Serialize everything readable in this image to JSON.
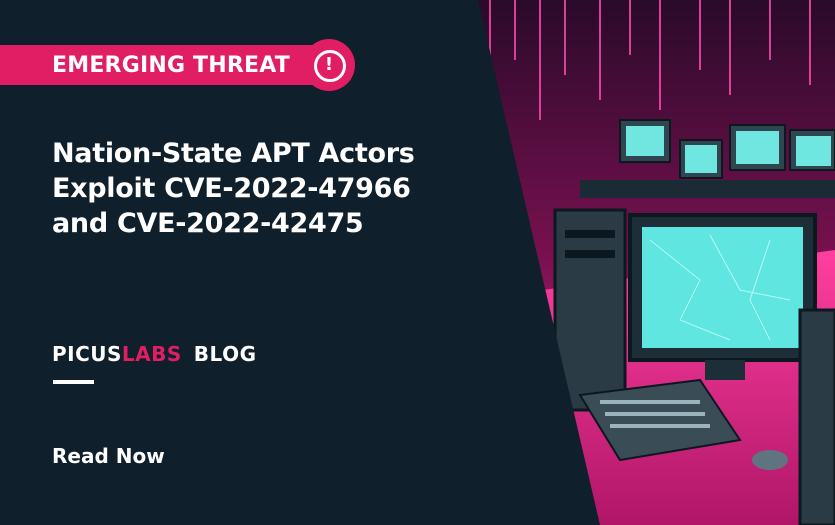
{
  "banner": {
    "badge_label": "EMERGING THREAT",
    "alert_icon": "exclamation-circle-icon",
    "title_lines": [
      "Nation-State APT Actors",
      "Exploit CVE-2022-47966",
      "and CVE-2022-42475"
    ],
    "logo": {
      "brand": "PICUS",
      "labs": "LABS",
      "blog": "BLOG"
    },
    "cta_label": "Read Now"
  },
  "colors": {
    "background": "#0f1f2b",
    "accent": "#e11d63",
    "text": "#ffffff",
    "screen": "#5fe6e0"
  }
}
